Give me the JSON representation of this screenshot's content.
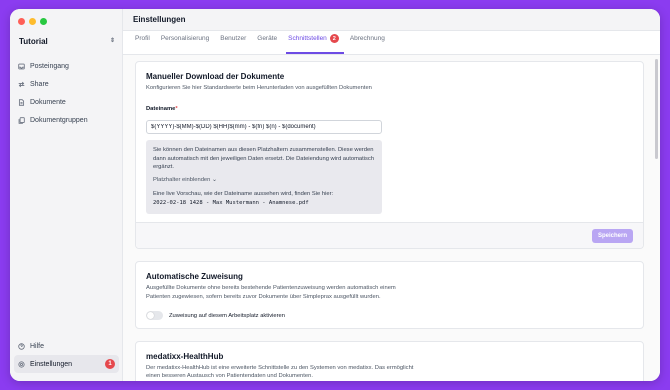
{
  "sidebar": {
    "workspace": "Tutorial",
    "items": [
      {
        "label": "Posteingang",
        "icon": "inbox-icon"
      },
      {
        "label": "Share",
        "icon": "share-icon"
      },
      {
        "label": "Dokumente",
        "icon": "document-icon"
      },
      {
        "label": "Dokumentgruppen",
        "icon": "document-group-icon"
      }
    ],
    "bottom_items": [
      {
        "label": "Hilfe",
        "icon": "help-icon"
      },
      {
        "label": "Einstellungen",
        "icon": "settings-icon",
        "badge": "1"
      }
    ]
  },
  "header": {
    "title": "Einstellungen"
  },
  "tabs": [
    {
      "label": "Profil"
    },
    {
      "label": "Personalisierung"
    },
    {
      "label": "Benutzer"
    },
    {
      "label": "Geräte"
    },
    {
      "label": "Schnittstellen",
      "badge": "2",
      "active": true
    },
    {
      "label": "Abrechnung"
    }
  ],
  "download_card": {
    "title": "Manueller Download der Dokumente",
    "description": "Konfigurieren Sie hier Standardwerte beim Herunterladen von ausgefüllten Dokumenten",
    "field_label": "Dateiname",
    "required_mark": "*",
    "field_value": "$(YYYY)-$(MM)-$(DD) $(HH)$(mm) - $(fn) $(n) - $(document)",
    "hint_text": "Sie können den Dateinamen aus diesen Platzhaltern zusammenstellen. Diese werden dann automatisch mit den jeweiligen Daten ersetzt. Die Dateiendung wird automatisch ergänzt.",
    "toggle_label": "Platzhalter einblenden",
    "preview_label": "Eine live Vorschau, wie der Dateiname aussehen wird, finden Sie hier:",
    "preview_value": "2022-02-18 1428 - Max Mustermann - Anamnese.pdf",
    "save_label": "Speichern"
  },
  "assign_card": {
    "title": "Automatische Zuweisung",
    "description": "Ausgefüllte Dokumente ohne bereits bestehende Patientenzuweisung werden automatisch einem Patienten zugewiesen, sofern bereits zuvor Dokumente über Simpleprax ausgefüllt wurden.",
    "switch_label": "Zuweisung auf diesem Arbeitsplatz aktivieren"
  },
  "healthhub_card": {
    "title": "medatixx-HealthHub",
    "description": "Der medatixx-HealthHub ist eine erweiterte Schnittstelle zu den Systemen von medatixx. Das ermöglicht einen besseren Austausch von Patientendaten und Dokumenten."
  }
}
